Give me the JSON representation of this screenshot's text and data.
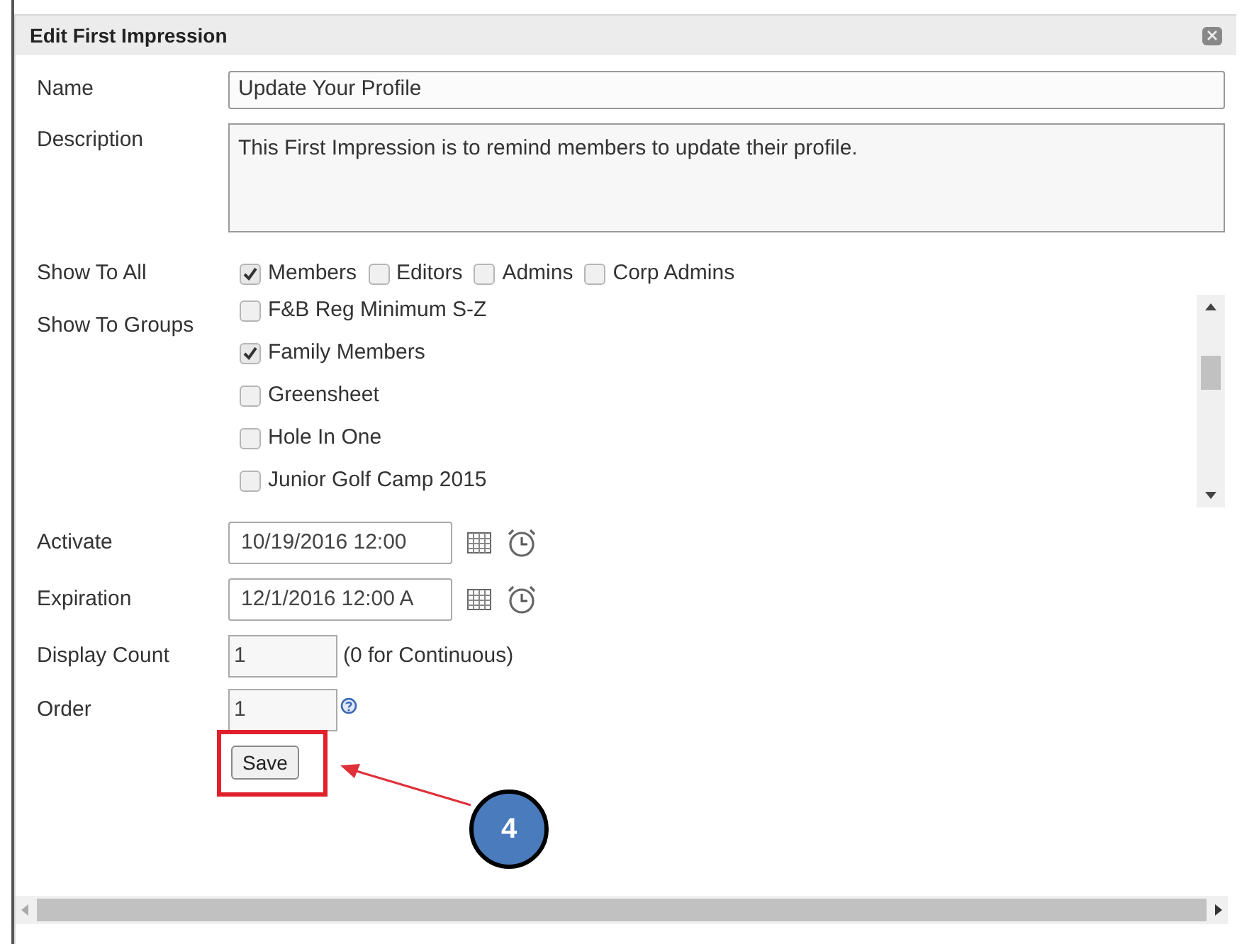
{
  "dialog": {
    "title": "Edit First Impression"
  },
  "fields": {
    "name": {
      "label": "Name",
      "value": "Update Your Profile"
    },
    "description": {
      "label": "Description",
      "value": "This First Impression is to remind members to update their profile."
    },
    "show_to_all": {
      "label": "Show To All",
      "options": [
        {
          "label": "Members",
          "checked": true
        },
        {
          "label": "Editors",
          "checked": false
        },
        {
          "label": "Admins",
          "checked": false
        },
        {
          "label": "Corp Admins",
          "checked": false
        }
      ]
    },
    "show_to_groups": {
      "label": "Show To Groups",
      "options": [
        {
          "label": "F&B Reg Minimum S-Z",
          "checked": false
        },
        {
          "label": "Family Members",
          "checked": true
        },
        {
          "label": "Greensheet",
          "checked": false
        },
        {
          "label": "Hole In One",
          "checked": false
        },
        {
          "label": "Junior Golf Camp 2015",
          "checked": false
        }
      ]
    },
    "activate": {
      "label": "Activate",
      "value": "10/19/2016 12:00"
    },
    "expiration": {
      "label": "Expiration",
      "value": "12/1/2016 12:00 A"
    },
    "display_count": {
      "label": "Display Count",
      "value": "1",
      "hint": "(0 for Continuous)"
    },
    "order": {
      "label": "Order",
      "value": "1"
    }
  },
  "save_button": "Save",
  "callout": {
    "number": "4"
  }
}
